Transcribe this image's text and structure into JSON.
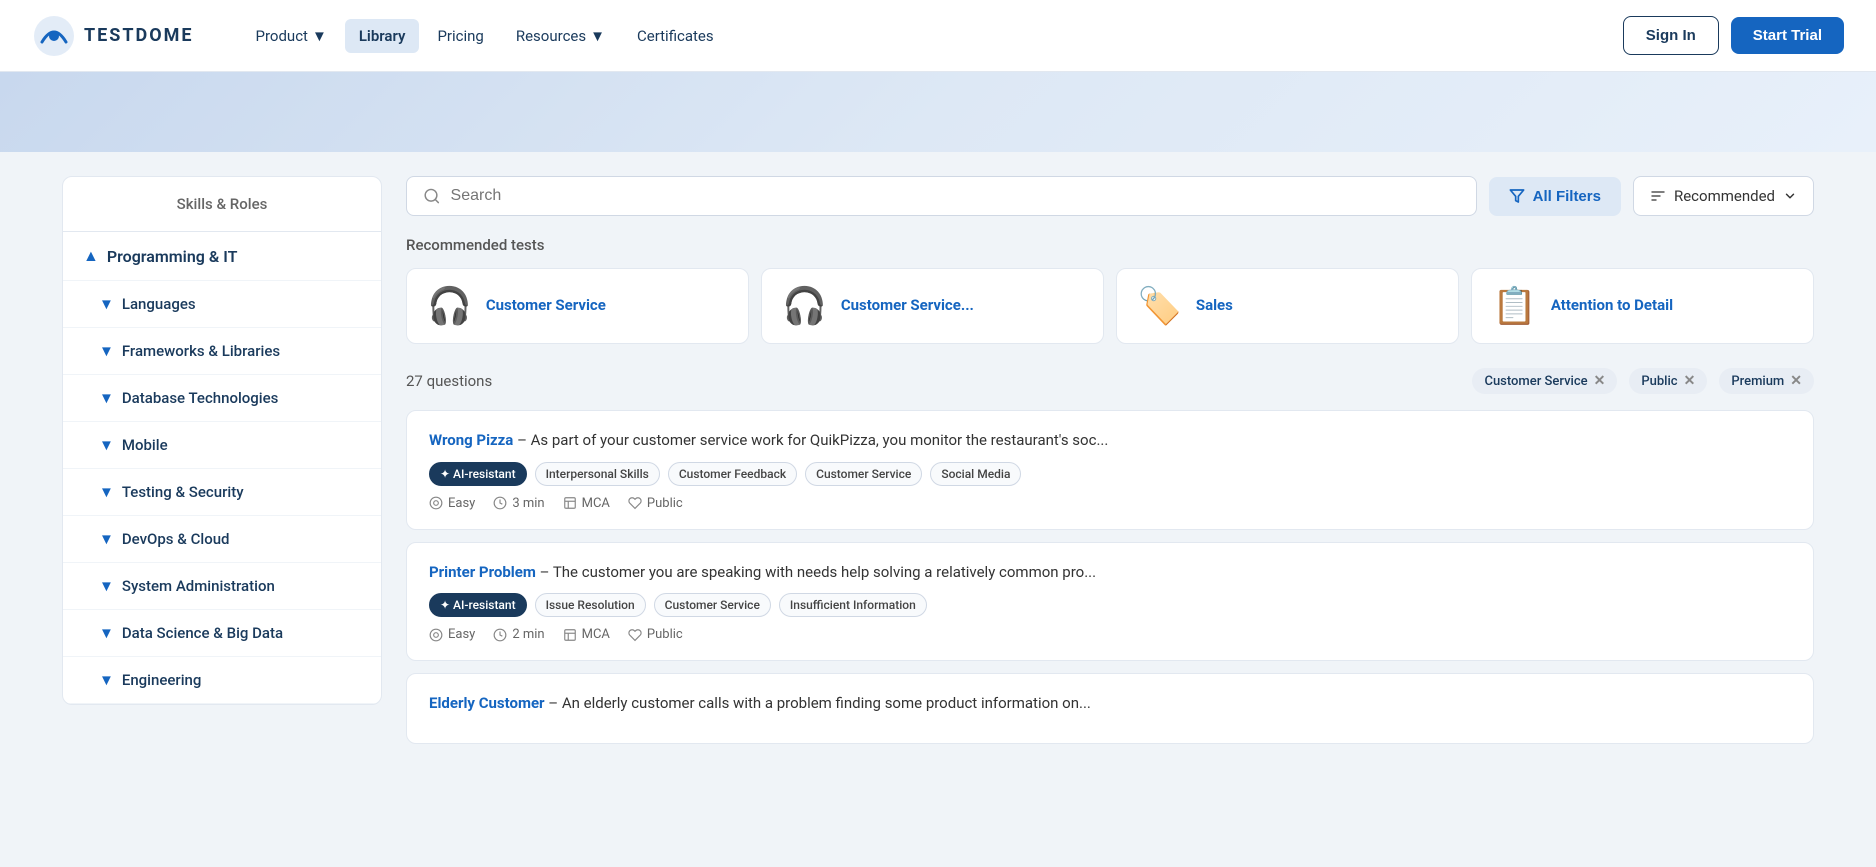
{
  "navbar": {
    "logo_text": "TESTDOME",
    "nav_links": [
      {
        "id": "product",
        "label": "Product",
        "has_arrow": true,
        "active": false
      },
      {
        "id": "library",
        "label": "Library",
        "has_arrow": false,
        "active": true
      },
      {
        "id": "pricing",
        "label": "Pricing",
        "has_arrow": false,
        "active": false
      },
      {
        "id": "resources",
        "label": "Resources",
        "has_arrow": true,
        "active": false
      },
      {
        "id": "certificates",
        "label": "Certificates",
        "has_arrow": false,
        "active": false
      }
    ],
    "signin_label": "Sign In",
    "trial_label": "Start Trial"
  },
  "sidebar": {
    "title": "Skills & Roles",
    "items": [
      {
        "id": "programming-it",
        "label": "Programming & IT",
        "level": 0,
        "chevron": "up"
      },
      {
        "id": "languages",
        "label": "Languages",
        "level": 1,
        "chevron": "down"
      },
      {
        "id": "frameworks",
        "label": "Frameworks & Libraries",
        "level": 1,
        "chevron": "down"
      },
      {
        "id": "database",
        "label": "Database Technologies",
        "level": 1,
        "chevron": "down"
      },
      {
        "id": "mobile",
        "label": "Mobile",
        "level": 1,
        "chevron": "down"
      },
      {
        "id": "testing",
        "label": "Testing & Security",
        "level": 1,
        "chevron": "down"
      },
      {
        "id": "devops",
        "label": "DevOps & Cloud",
        "level": 1,
        "chevron": "down"
      },
      {
        "id": "sysadmin",
        "label": "System Administration",
        "level": 1,
        "chevron": "down"
      },
      {
        "id": "datascience",
        "label": "Data Science & Big Data",
        "level": 1,
        "chevron": "down"
      },
      {
        "id": "engineering",
        "label": "Engineering",
        "level": 1,
        "chevron": "down"
      }
    ]
  },
  "search": {
    "placeholder": "Search",
    "filter_label": "All Filters",
    "sort_label": "Recommended"
  },
  "recommended": {
    "section_label": "Recommended tests",
    "cards": [
      {
        "id": "cs1",
        "icon": "🎧",
        "label": "Customer Service"
      },
      {
        "id": "cs2",
        "icon": "🎧",
        "label": "Customer Service..."
      },
      {
        "id": "sales",
        "icon": "🏷️",
        "label": "Sales"
      },
      {
        "id": "atd",
        "icon": "📋",
        "label": "Attention to Detail"
      }
    ]
  },
  "filters": {
    "count_label": "27 questions",
    "active_filters": [
      {
        "id": "cs",
        "label": "Customer Service"
      },
      {
        "id": "public",
        "label": "Public"
      },
      {
        "id": "premium",
        "label": "Premium"
      }
    ]
  },
  "questions": [
    {
      "id": "wrong-pizza",
      "title_link": "Wrong Pizza",
      "description": " – As part of your customer service work for QuikPizza, you monitor the restaurant's soc...",
      "tags": [
        {
          "id": "ai",
          "label": "✦ AI-resistant",
          "type": "ai-resistant"
        },
        {
          "id": "interpersonal",
          "label": "Interpersonal Skills",
          "type": "normal"
        },
        {
          "id": "feedback",
          "label": "Customer Feedback",
          "type": "normal"
        },
        {
          "id": "cs",
          "label": "Customer Service",
          "type": "normal"
        },
        {
          "id": "social",
          "label": "Social Media",
          "type": "normal"
        }
      ],
      "difficulty": "Easy",
      "time": "3 min",
      "format": "MCA",
      "visibility": "Public"
    },
    {
      "id": "printer-problem",
      "title_link": "Printer Problem",
      "description": " – The customer you are speaking with needs help solving a relatively common pro...",
      "tags": [
        {
          "id": "ai",
          "label": "✦ AI-resistant",
          "type": "ai-resistant"
        },
        {
          "id": "issue",
          "label": "Issue Resolution",
          "type": "normal"
        },
        {
          "id": "cs",
          "label": "Customer Service",
          "type": "normal"
        },
        {
          "id": "info",
          "label": "Insufficient Information",
          "type": "normal"
        }
      ],
      "difficulty": "Easy",
      "time": "2 min",
      "format": "MCA",
      "visibility": "Public"
    },
    {
      "id": "elderly-customer",
      "title_link": "Elderly Customer",
      "description": " – An elderly customer calls with a problem finding some product information on...",
      "tags": [],
      "difficulty": "",
      "time": "",
      "format": "",
      "visibility": ""
    }
  ]
}
